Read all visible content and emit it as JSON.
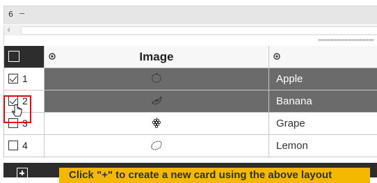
{
  "toolbar": {
    "counter": "6",
    "dash": "–"
  },
  "table": {
    "columns": [
      {
        "key": "select",
        "label": ""
      },
      {
        "key": "image",
        "label": "Image",
        "visibility_icon": "eye-icon"
      },
      {
        "key": "name",
        "label": "",
        "visibility_icon": "eye-icon"
      }
    ],
    "rows": [
      {
        "index": "1",
        "checked": true,
        "selected": true,
        "thumbnail": "apple-sketch",
        "name": "Apple"
      },
      {
        "index": "2",
        "checked": true,
        "selected": true,
        "thumbnail": "banana-sketch",
        "name": "Banana"
      },
      {
        "index": "3",
        "checked": false,
        "selected": false,
        "thumbnail": "grape-sketch",
        "name": "Grape"
      },
      {
        "index": "4",
        "checked": false,
        "selected": false,
        "thumbnail": "lemon-sketch",
        "name": "Lemon"
      }
    ]
  },
  "footer": {
    "add_icon": "plus-icon",
    "hint": "Click \"+\" to create a new card using the above layout"
  },
  "colors": {
    "header_dark": "#2d2d2d",
    "selected_row": "#6b6b6b",
    "hint_bg": "#f5b800",
    "focus_outline": "#e00000"
  }
}
